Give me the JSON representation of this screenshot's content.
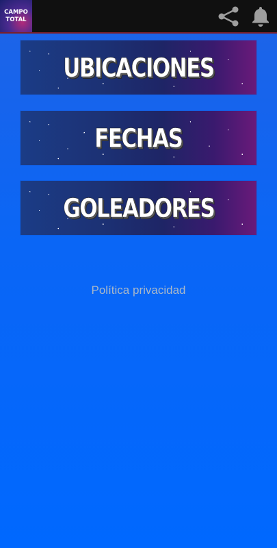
{
  "header": {
    "logo_line1": "CAMPO",
    "logo_line2": "TOTAL",
    "share_icon": "share-icon",
    "bell_icon": "notification-bell-icon"
  },
  "menu": {
    "items": [
      {
        "label": "UBICACIONES"
      },
      {
        "label": "FECHAS"
      },
      {
        "label": "GOLEADORES"
      }
    ]
  },
  "footer": {
    "privacy_link": "Política privacidad"
  },
  "colors": {
    "background": "#0a66f6",
    "topbar": "#101010",
    "privacy_text": "#aab8c8"
  }
}
